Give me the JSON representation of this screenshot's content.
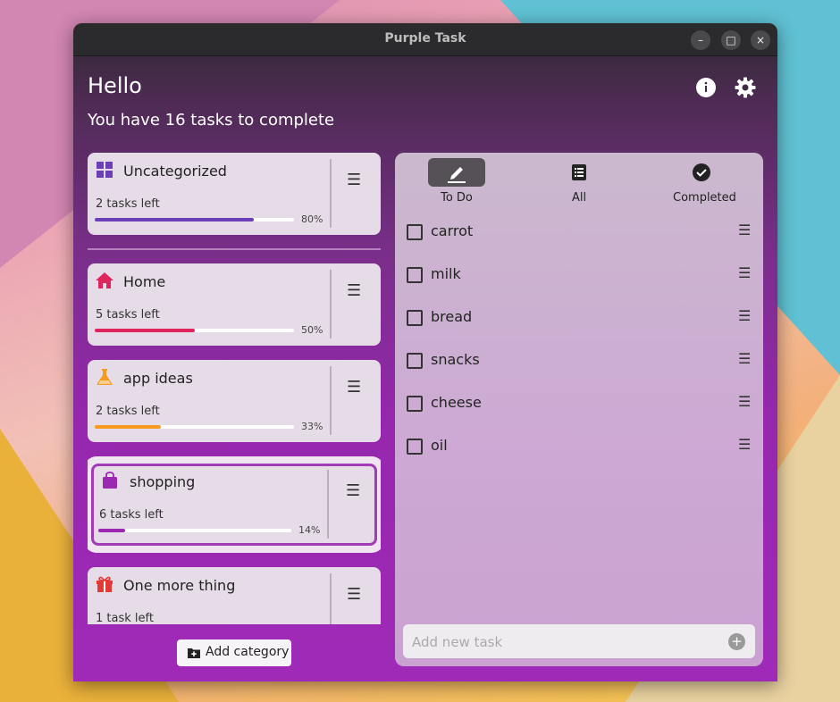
{
  "window": {
    "title": "Purple Task",
    "minimize": "–",
    "maximize": "□",
    "close": "×"
  },
  "header": {
    "greeting": "Hello",
    "subtitle": "You have 16 tasks to complete",
    "info_icon": "info-icon",
    "settings_icon": "gear-icon"
  },
  "categories": [
    {
      "name": "Uncategorized",
      "left": "2 tasks left",
      "percent": "80%",
      "progress": 0.8,
      "color": "#6a3fb8",
      "icon": "grid-icon"
    },
    {
      "name": "Home",
      "left": "5 tasks left",
      "percent": "50%",
      "progress": 0.5,
      "color": "#e0245e",
      "icon": "home-icon"
    },
    {
      "name": "app ideas",
      "left": "2 tasks left",
      "percent": "33%",
      "progress": 0.33,
      "color": "#f79a1e",
      "icon": "flask-icon"
    },
    {
      "name": "shopping",
      "left": "6 tasks left",
      "percent": "14%",
      "progress": 0.14,
      "color": "#9c27b0",
      "icon": "shopping-bag-icon"
    },
    {
      "name": "One more thing",
      "left": "1 task left",
      "percent": "",
      "progress": 0,
      "color": "#e53935",
      "icon": "gift-icon"
    }
  ],
  "add_category": "Add category",
  "tabs": [
    {
      "label": "To Do",
      "icon": "pencil-icon",
      "active": true
    },
    {
      "label": "All",
      "icon": "list-icon",
      "active": false
    },
    {
      "label": "Completed",
      "icon": "check-circle-icon",
      "active": false
    }
  ],
  "tasks": [
    "carrot",
    "milk",
    "bread",
    "snacks",
    "cheese",
    "oil"
  ],
  "new_task": {
    "placeholder": "Add new task",
    "add_icon": "plus-circle-icon"
  },
  "colors": {
    "accent": "#9c27b0",
    "panel": "#cdb0d3"
  }
}
